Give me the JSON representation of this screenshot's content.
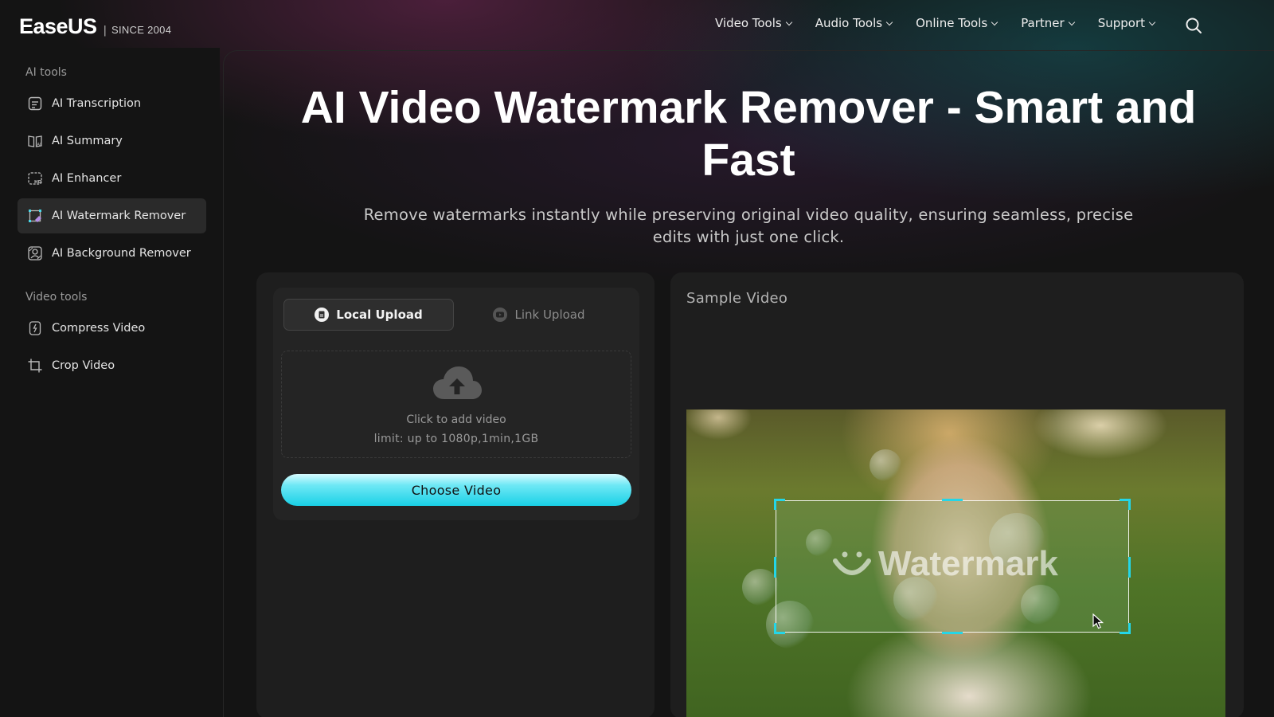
{
  "brand": {
    "name": "EaseUS",
    "since": "SINCE 2004"
  },
  "topnav": [
    {
      "label": "Video Tools"
    },
    {
      "label": "Audio Tools"
    },
    {
      "label": "Online Tools"
    },
    {
      "label": "Partner"
    },
    {
      "label": "Support"
    }
  ],
  "sidebar": {
    "ai_section": "AI tools",
    "ai_items": [
      {
        "label": "AI Transcription",
        "icon": "transcription-icon"
      },
      {
        "label": "AI Summary",
        "icon": "summary-icon"
      },
      {
        "label": "AI Enhancer",
        "icon": "enhancer-hd-icon"
      },
      {
        "label": "AI Watermark Remover",
        "icon": "watermark-remover-icon",
        "active": true
      },
      {
        "label": "AI Background Remover",
        "icon": "background-remover-icon"
      }
    ],
    "video_section": "Video tools",
    "video_items": [
      {
        "label": "Compress Video",
        "icon": "compress-icon"
      },
      {
        "label": "Crop Video",
        "icon": "crop-icon"
      }
    ]
  },
  "hero": {
    "title": "AI Video Watermark Remover - Smart and Fast",
    "subtitle": "Remove watermarks instantly while preserving original video quality, ensuring seamless, precise edits with just one click."
  },
  "upload": {
    "tabs": [
      {
        "label": "Local Upload",
        "active": true
      },
      {
        "label": "Link Upload",
        "active": false
      }
    ],
    "dropzone_text": "Click to add video",
    "limit_text": "limit: up to 1080p,1min,1GB",
    "choose_button": "Choose Video"
  },
  "sample": {
    "label": "Sample Video",
    "watermark_text": "Watermark"
  },
  "colors": {
    "accent": "#19d0e6",
    "background": "#141414",
    "card": "#1e1e1e"
  }
}
